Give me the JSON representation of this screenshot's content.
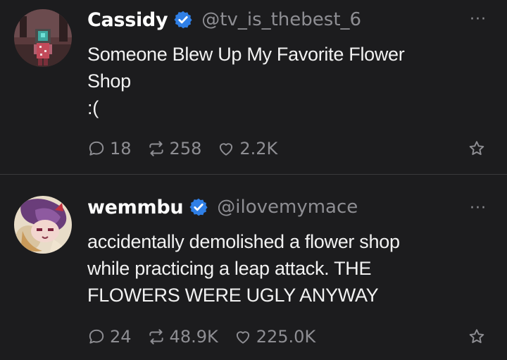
{
  "posts": [
    {
      "name": "Cassidy",
      "handle": "@tv_is_thebest_6",
      "verified": true,
      "text": "Someone Blew Up My Favorite Flower\nShop\n:(",
      "replies": "18",
      "reposts": "258",
      "likes": "2.2K",
      "more_label": "···"
    },
    {
      "name": "wemmbu",
      "handle": "@ilovemymace",
      "verified": true,
      "text": "accidentally demolished a flower shop\nwhile practicing a leap attack. THE\nFLOWERS WERE UGLY ANYWAY",
      "replies": "24",
      "reposts": "48.9K",
      "likes": "225.0K",
      "more_label": "···"
    }
  ],
  "colors": {
    "background": "#1c1c1e",
    "verified_badge": "#2f7fe6",
    "muted": "#8e8e93",
    "divider": "#3a3a3c"
  },
  "icons": [
    "verified-badge-icon",
    "reply-icon",
    "repost-icon",
    "like-icon",
    "bookmark-star-icon",
    "more-icon"
  ]
}
